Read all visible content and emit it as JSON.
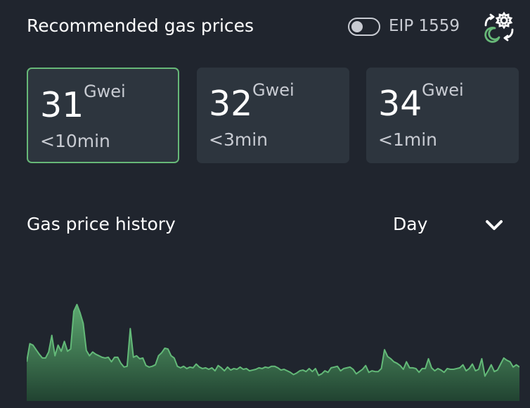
{
  "header": {
    "title": "Recommended gas prices",
    "eip_label": "EIP 1559",
    "eip_enabled": false,
    "settings_icon": "settings-theme-icon"
  },
  "price_cards": [
    {
      "price": "31",
      "unit": "Gwei",
      "time": "<10min",
      "selected": true
    },
    {
      "price": "32",
      "unit": "Gwei",
      "time": "<3min",
      "selected": false
    },
    {
      "price": "34",
      "unit": "Gwei",
      "time": "<1min",
      "selected": false
    }
  ],
  "history": {
    "title": "Gas price history",
    "range": "Day",
    "dropdown_icon": "chevron-down-icon"
  },
  "colors": {
    "background": "#20252e",
    "card_background": "#2d353e",
    "accent": "#67b878",
    "text_primary": "#ffffff",
    "text_secondary": "#c8cbd2",
    "chart_fill_top": "#5fae73",
    "chart_fill_bottom": "#214431"
  },
  "chart_data": {
    "type": "area",
    "title": "",
    "xlabel": "",
    "ylabel": "",
    "ylim": [
      0,
      140
    ],
    "grid": false,
    "legend": "none",
    "series": [
      {
        "values": [
          52,
          76,
          74,
          68,
          62,
          57,
          57,
          65,
          87,
          60,
          74,
          66,
          79,
          66,
          69,
          119,
          128,
          117,
          103,
          67,
          60,
          65,
          62,
          60,
          58,
          57,
          58,
          52,
          58,
          58,
          50,
          45,
          46,
          96,
          58,
          60,
          56,
          57,
          47,
          45,
          46,
          48,
          60,
          64,
          70,
          69,
          60,
          57,
          46,
          44,
          46,
          43,
          45,
          44,
          49,
          45,
          43,
          44,
          42,
          44,
          40,
          47,
          44,
          40,
          45,
          41,
          43,
          42,
          45,
          42,
          43,
          40,
          41,
          42,
          44,
          43,
          45,
          44,
          46,
          46,
          44,
          41,
          42,
          40,
          38,
          35,
          37,
          40,
          41,
          39,
          43,
          39,
          43,
          34,
          36,
          40,
          38,
          44,
          45,
          46,
          40,
          43,
          44,
          45,
          42,
          36,
          39,
          42,
          47,
          38,
          40,
          39,
          39,
          43,
          68,
          59,
          56,
          52,
          50,
          47,
          42,
          52,
          44,
          44,
          43,
          38,
          43,
          43,
          56,
          44,
          40,
          43,
          41,
          38,
          43,
          42,
          42,
          43,
          44,
          48,
          40,
          43,
          49,
          40,
          42,
          56,
          33,
          40,
          48,
          39,
          41,
          49,
          57,
          54,
          52,
          45,
          48,
          45
        ]
      }
    ]
  }
}
